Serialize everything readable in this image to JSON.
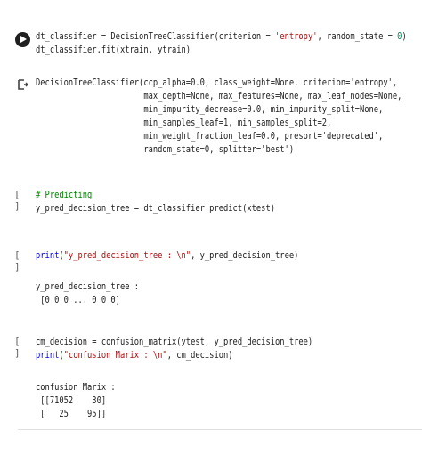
{
  "cells": [
    {
      "gutter": "",
      "code": [
        "dt_classifier = DecisionTreeClassifier(criterion = 'entropy', random_state = 0)",
        "dt_classifier.fit(xtrain, ytrain)"
      ],
      "output": [
        "DecisionTreeClassifier(ccp_alpha=0.0, class_weight=None, criterion='entropy',",
        "                       max_depth=None, max_features=None, max_leaf_nodes=None,",
        "                       min_impurity_decrease=0.0, min_impurity_split=None,",
        "                       min_samples_leaf=1, min_samples_split=2,",
        "                       min_weight_fraction_leaf=0.0, presort='deprecated',",
        "                       random_state=0, splitter='best')"
      ]
    },
    {
      "gutter": "[ ]",
      "code": [
        "# Predicting",
        "y_pred_decision_tree = dt_classifier.predict(xtest)"
      ]
    },
    {
      "gutter": "[ ]",
      "code": [
        "print(\"y_pred_decision_tree : \\n\", y_pred_decision_tree)"
      ],
      "output": [
        "y_pred_decision_tree :",
        " [0 0 0 ... 0 0 0]"
      ]
    },
    {
      "gutter": "[ ]",
      "code": [
        "cm_decision = confusion_matrix(ytest, y_pred_decision_tree)",
        "print(\"confusion Marix : \\n\", cm_decision)"
      ],
      "output": [
        "confusion Marix :",
        " [[71052    30]",
        " [   25    95]]"
      ]
    }
  ]
}
